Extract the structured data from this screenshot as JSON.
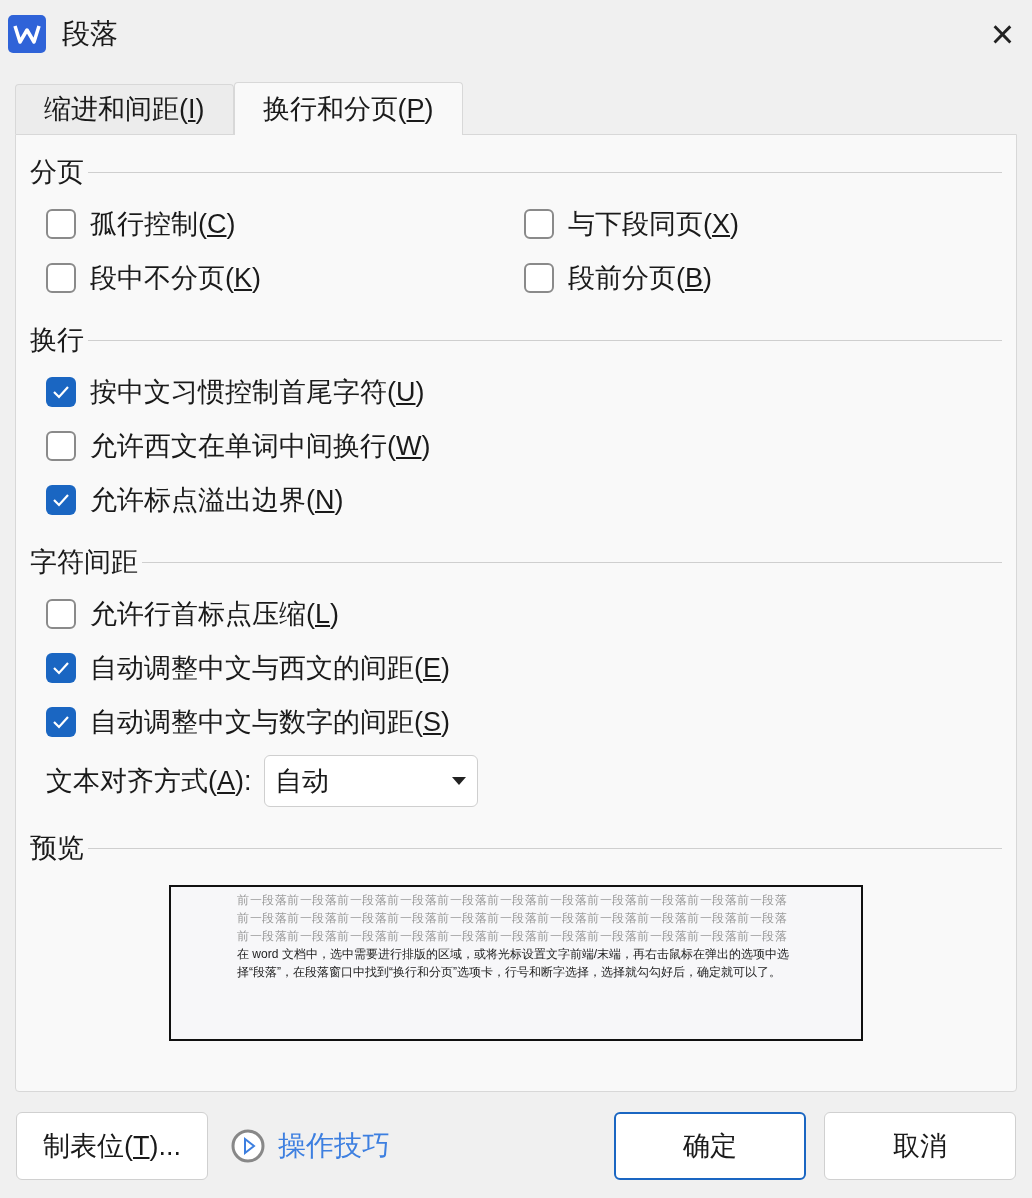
{
  "window": {
    "title": "段落",
    "close": "×"
  },
  "tabs": [
    {
      "label": "缩进和间距(",
      "key": "I",
      "tail": ")",
      "selected": false
    },
    {
      "label": "换行和分页(",
      "key": "P",
      "tail": ")",
      "selected": true
    }
  ],
  "sections": [
    {
      "title": "分页",
      "kind": "grid",
      "items": [
        {
          "kind": "checkbox",
          "label": "孤行控制(",
          "key": "C",
          "tail": ")",
          "checked": false
        },
        {
          "kind": "checkbox",
          "label": "与下段同页(",
          "key": "X",
          "tail": ")",
          "checked": false
        },
        {
          "kind": "checkbox",
          "label": "段中不分页(",
          "key": "K",
          "tail": ")",
          "checked": false
        },
        {
          "kind": "checkbox",
          "label": "段前分页(",
          "key": "B",
          "tail": ")",
          "checked": false
        }
      ]
    },
    {
      "title": "换行",
      "kind": "list",
      "items": [
        {
          "kind": "checkbox",
          "label": "按中文习惯控制首尾字符(",
          "key": "U",
          "tail": ")",
          "checked": true
        },
        {
          "kind": "checkbox",
          "label": "允许西文在单词中间换行(",
          "key": "W",
          "tail": ")",
          "checked": false
        },
        {
          "kind": "checkbox",
          "label": "允许标点溢出边界(",
          "key": "N",
          "tail": ")",
          "checked": true
        }
      ]
    },
    {
      "title": "字符间距",
      "kind": "list",
      "items": [
        {
          "kind": "checkbox",
          "label": "允许行首标点压缩(",
          "key": "L",
          "tail": ")",
          "checked": false
        },
        {
          "kind": "checkbox",
          "label": "自动调整中文与西文的间距(",
          "key": "E",
          "tail": ")",
          "checked": true
        },
        {
          "kind": "checkbox",
          "label": "自动调整中文与数字的间距(",
          "key": "S",
          "tail": ")",
          "checked": true
        },
        {
          "kind": "select",
          "label": "文本对齐方式(",
          "key": "A",
          "tail": "):",
          "value": "自动"
        }
      ]
    }
  ],
  "preview": {
    "title": "预览",
    "before_lines": [
      "前一段落前一段落前一段落前一段落前一段落前一段落前一段落前一段落前一段落前一段落前一段落",
      "前一段落前一段落前一段落前一段落前一段落前一段落前一段落前一段落前一段落前一段落前一段落",
      "前一段落前一段落前一段落前一段落前一段落前一段落前一段落前一段落前一段落前一段落前一段落"
    ],
    "sample": "在 word 文档中，选中需要进行排版的区域，或将光标设置文字前端/末端，再右击鼠标在弹出的选项中选择“段落”，在段落窗口中找到“换行和分页”选项卡，行号和断字选择，选择就勾勾好后，确定就可以了。"
  },
  "footer": {
    "tabs_button": {
      "label": "制表位(",
      "key": "T",
      "tail": ")..."
    },
    "tips_link": "操作技巧",
    "buttons": [
      {
        "label": "确定",
        "kind": "primary"
      },
      {
        "label": "取消",
        "kind": "normal"
      }
    ]
  }
}
